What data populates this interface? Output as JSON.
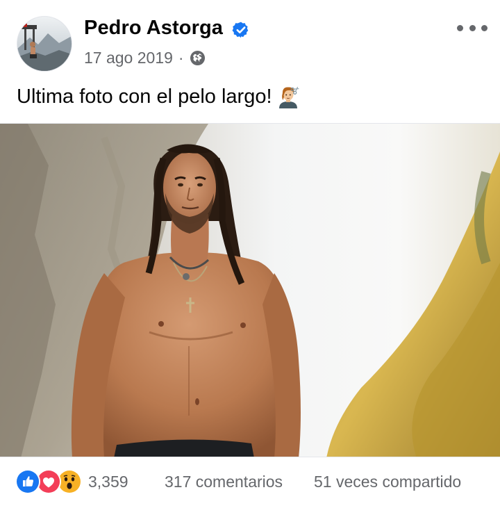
{
  "post": {
    "author": {
      "name": "Pedro Astorga",
      "verified_icon": "verified-badge-icon",
      "verified_color": "#1877f2"
    },
    "date": "17 ago 2019",
    "separator": "·",
    "audience_icon": "globe-icon",
    "more_icon": "more-options-icon",
    "caption": {
      "text": "Ultima foto con el pelo largo!",
      "emoji_icon": "person-getting-haircut-icon"
    },
    "photo": {
      "kind": "photo",
      "alt_icon": "post-photo"
    }
  },
  "footer": {
    "reactions": {
      "icons": [
        "like-icon",
        "love-icon",
        "wow-icon"
      ],
      "count": "3,359",
      "colors": {
        "like": "#1877f2",
        "love": "#f33e58",
        "wow": "#f7b125"
      }
    },
    "comments": "317 comentarios",
    "shares": "51 veces compartido"
  },
  "theme": {
    "text_primary": "#050505",
    "text_secondary": "#65676b",
    "divider": "#e4e6eb"
  }
}
